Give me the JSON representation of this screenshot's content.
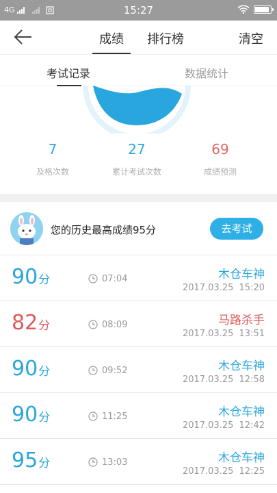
{
  "status_bar": {
    "network": "4G",
    "time": "15:27"
  },
  "nav": {
    "tab_scores": "成绩",
    "tab_ranking": "排行榜",
    "clear_label": "清空"
  },
  "subtabs": {
    "records": "考试记录",
    "stats": "数据统计"
  },
  "stats": [
    {
      "value": "7",
      "label": "及格次数",
      "color": "#2aa6de"
    },
    {
      "value": "27",
      "label": "累计考试次数",
      "color": "#2aa6de"
    },
    {
      "value": "69",
      "label": "成绩预测",
      "color": "#e06666"
    }
  ],
  "best": {
    "text": "您的历史最高成绩95分",
    "button": "去考试"
  },
  "colors": {
    "blue": "#2aa6de",
    "red": "#de5a5a",
    "button": "#2eb0e6"
  },
  "records": [
    {
      "score": "90",
      "unit": "分",
      "duration": "07:04",
      "title": "木仓车神",
      "date": "2017.03.25 15:20",
      "color": "#2aa6de"
    },
    {
      "score": "82",
      "unit": "分",
      "duration": "08:09",
      "title": "马路杀手",
      "date": "2017.03.25 13:51",
      "color": "#de5a5a"
    },
    {
      "score": "90",
      "unit": "分",
      "duration": "09:52",
      "title": "木仓车神",
      "date": "2017.03.25 12:58",
      "color": "#2aa6de"
    },
    {
      "score": "90",
      "unit": "分",
      "duration": "11:25",
      "title": "木仓车神",
      "date": "2017.03.25 12:42",
      "color": "#2aa6de"
    },
    {
      "score": "95",
      "unit": "分",
      "duration": "13:03",
      "title": "木仓车神",
      "date": "2017.03.25 12:25",
      "color": "#2aa6de"
    }
  ]
}
